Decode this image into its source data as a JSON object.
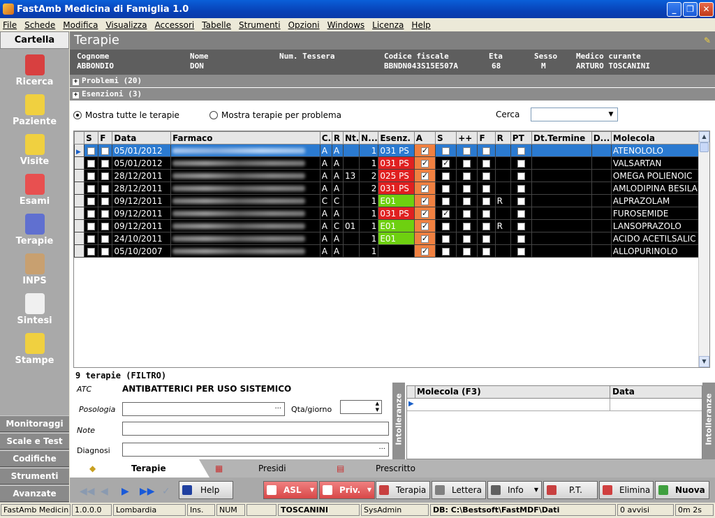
{
  "app": {
    "title": "FastAmb Medicina di Famiglia 1.0"
  },
  "menu": [
    "File",
    "Schede",
    "Modifica",
    "Visualizza",
    "Accessori",
    "Tabelle",
    "Strumenti",
    "Opzioni",
    "Windows",
    "Licenza",
    "Help"
  ],
  "nav": {
    "header": "Cartella",
    "items": [
      {
        "label": "Ricerca",
        "icon": "people-icon",
        "color": "#d84040"
      },
      {
        "label": "Paziente",
        "icon": "person-icon",
        "color": "#f0d040"
      },
      {
        "label": "Visite",
        "icon": "doctor-icon",
        "color": "#f0d040"
      },
      {
        "label": "Esami",
        "icon": "ecg-icon",
        "color": "#e85050"
      },
      {
        "label": "Terapie",
        "icon": "pill-icon",
        "color": "#6070d0"
      },
      {
        "label": "INPS",
        "icon": "bed-icon",
        "color": "#c8a070"
      },
      {
        "label": "Sintesi",
        "icon": "document-icon",
        "color": "#f0f0f0"
      },
      {
        "label": "Stampe",
        "icon": "printer-doc-icon",
        "color": "#f0d040"
      }
    ],
    "bottom": [
      "Monitoraggi",
      "Scale e Test",
      "Codifiche",
      "Strumenti",
      "Avanzate"
    ]
  },
  "header": {
    "title": "Terapie"
  },
  "patient": {
    "labels": [
      "Cognome",
      "Nome",
      "Num. Tessera",
      "Codice fiscale",
      "Eta",
      "Sesso",
      "Medico curante"
    ],
    "values": [
      "ABBONDIO",
      "DON",
      "",
      "BBNDN043S15E507A",
      "68",
      "M",
      "ARTURO TOSCANINI"
    ]
  },
  "bands": {
    "problemi": "Problemi (20)",
    "esenzioni": "Esenzioni (3)"
  },
  "filter": {
    "opt1": "Mostra tutte le terapie",
    "opt2": "Mostra terapie per problema",
    "cerca": "Cerca"
  },
  "table": {
    "columns": [
      "S",
      "F",
      "Data",
      "Farmaco",
      "C.",
      "R",
      "Nt.",
      "N...",
      "Esenz.",
      "A",
      "S",
      "++",
      "F",
      "R",
      "PT",
      "Dt.Termine",
      "D...",
      "Molecola"
    ],
    "rows": [
      {
        "s": false,
        "f": false,
        "date": "05/01/2012",
        "c": "A",
        "r": "A",
        "nt": "",
        "n": "1",
        "esenz": "031 PS",
        "ecolor": "red",
        "a": true,
        "s2": false,
        "pp": false,
        "f2": false,
        "r2": "",
        "pt": false,
        "mol": "ATENOLOLO"
      },
      {
        "s": false,
        "f": false,
        "date": "05/01/2012",
        "c": "A",
        "r": "A",
        "nt": "",
        "n": "1",
        "esenz": "031 PS",
        "ecolor": "red",
        "a": true,
        "s2": true,
        "pp": false,
        "f2": false,
        "r2": "",
        "pt": false,
        "mol": "VALSARTAN"
      },
      {
        "s": false,
        "f": false,
        "date": "28/12/2011",
        "c": "A",
        "r": "A",
        "nt": "13",
        "n": "2",
        "esenz": "025 PS",
        "ecolor": "red",
        "a": true,
        "s2": false,
        "pp": false,
        "f2": false,
        "r2": "",
        "pt": false,
        "mol": "OMEGA POLIENOIC"
      },
      {
        "s": false,
        "f": false,
        "date": "28/12/2011",
        "c": "A",
        "r": "A",
        "nt": "",
        "n": "2",
        "esenz": "031 PS",
        "ecolor": "red",
        "a": true,
        "s2": false,
        "pp": false,
        "f2": false,
        "r2": "",
        "pt": false,
        "mol": "AMLODIPINA BESILA"
      },
      {
        "s": false,
        "f": false,
        "date": "09/12/2011",
        "c": "C",
        "r": "C",
        "nt": "",
        "n": "1",
        "esenz": "E01",
        "ecolor": "green",
        "a": true,
        "s2": false,
        "pp": false,
        "f2": false,
        "r2": "R",
        "pt": false,
        "mol": "ALPRAZOLAM"
      },
      {
        "s": false,
        "f": false,
        "date": "09/12/2011",
        "c": "A",
        "r": "A",
        "nt": "",
        "n": "1",
        "esenz": "031 PS",
        "ecolor": "red",
        "a": true,
        "s2": true,
        "pp": false,
        "f2": false,
        "r2": "",
        "pt": false,
        "mol": "FUROSEMIDE"
      },
      {
        "s": false,
        "f": false,
        "date": "09/12/2011",
        "c": "A",
        "r": "C",
        "nt": "01",
        "n": "1",
        "esenz": "E01",
        "ecolor": "green",
        "a": true,
        "s2": false,
        "pp": false,
        "f2": false,
        "r2": "R",
        "pt": false,
        "mol": "LANSOPRAZOLO"
      },
      {
        "s": false,
        "f": false,
        "date": "24/10/2011",
        "c": "A",
        "r": "A",
        "nt": "",
        "n": "1",
        "esenz": "E01",
        "ecolor": "green",
        "a": true,
        "s2": false,
        "pp": false,
        "f2": false,
        "r2": "",
        "pt": false,
        "mol": "ACIDO ACETILSALIC"
      },
      {
        "s": false,
        "f": false,
        "date": "05/10/2007",
        "c": "A",
        "r": "A",
        "nt": "",
        "n": "1",
        "esenz": "",
        "ecolor": "none",
        "a": true,
        "s2": false,
        "pp": false,
        "f2": false,
        "r2": "",
        "pt": false,
        "mol": "ALLOPURINOLO"
      }
    ]
  },
  "detail": {
    "count": "9 terapie (FILTRO)",
    "atc_label": "ATC",
    "atc_value": "ANTIBATTERICI PER USO SISTEMICO",
    "posologia": "Posologia",
    "qta": "Qta/giorno",
    "note": "Note",
    "diagnosi": "Diagnosi"
  },
  "intolleranze": {
    "side": "Intolleranze",
    "cols": [
      "Molecola  (F3)",
      "Data"
    ]
  },
  "tabs": [
    "Terapie",
    "Presidi",
    "Prescritto"
  ],
  "buttons": {
    "help": "Help",
    "asl": "ASL",
    "priv": "Priv.",
    "terapia": "Terapia",
    "lettera": "Lettera",
    "info": "Info",
    "pt": "P.T.",
    "elimina": "Elimina",
    "nuova": "Nuova"
  },
  "status": [
    "FastAmb Medicin",
    "1.0.0.0",
    "Lombardia",
    "Ins.",
    "NUM",
    "",
    "TOSCANINI",
    "SysAdmin",
    "DB: C:\\Bestsoft\\FastMDF\\Dati",
    "0 avvisi",
    "0m 2s"
  ]
}
